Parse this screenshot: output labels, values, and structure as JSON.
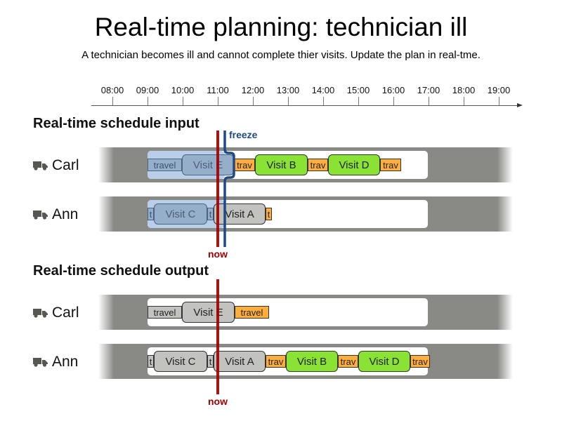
{
  "title": "Real-time planning: technician ill",
  "subtitle": "A technician becomes ill and cannot complete thier visits. Update the plan in real-tme.",
  "timeline": {
    "ticks": [
      "08:00",
      "09:00",
      "10:00",
      "11:00",
      "12:00",
      "13:00",
      "14:00",
      "15:00",
      "16:00",
      "17:00",
      "18:00",
      "19:00"
    ]
  },
  "colors": {
    "now": "#a40000",
    "freeze": "#204a87",
    "travel": "#ffad3b",
    "visit_new": "#8ae234",
    "visit_pinned": "#c2c3bf",
    "frozen_area": "#b9cfe9",
    "row_band": "#898a85"
  },
  "markers": {
    "now_label": "now",
    "freeze_label": "freeze"
  },
  "input": {
    "section_title": "Real-time schedule input",
    "rows": [
      {
        "technician": "Carl",
        "blocks": [
          {
            "type": "travel",
            "label": "travel",
            "state": "frozen"
          },
          {
            "type": "visit",
            "label": "Visit E",
            "state": "frozen"
          },
          {
            "type": "travel",
            "label": "trav",
            "state": "orange"
          },
          {
            "type": "visit",
            "label": "Visit B",
            "state": "green"
          },
          {
            "type": "travel",
            "label": "trav",
            "state": "orange"
          },
          {
            "type": "visit",
            "label": "Visit D",
            "state": "green"
          },
          {
            "type": "travel",
            "label": "trav",
            "state": "orange"
          }
        ]
      },
      {
        "technician": "Ann",
        "blocks": [
          {
            "type": "travel",
            "label": "t",
            "state": "frozen"
          },
          {
            "type": "visit",
            "label": "Visit C",
            "state": "frozen"
          },
          {
            "type": "travel",
            "label": "t",
            "state": "frozen"
          },
          {
            "type": "visit",
            "label": "Visit A",
            "state": "grey"
          },
          {
            "type": "travel",
            "label": "t",
            "state": "orange"
          }
        ]
      }
    ]
  },
  "output": {
    "section_title": "Real-time schedule output",
    "rows": [
      {
        "technician": "Carl",
        "blocks": [
          {
            "type": "travel",
            "label": "travel",
            "state": "grey"
          },
          {
            "type": "visit",
            "label": "Visit E",
            "state": "grey"
          },
          {
            "type": "travel",
            "label": "travel",
            "state": "orange"
          }
        ]
      },
      {
        "technician": "Ann",
        "blocks": [
          {
            "type": "travel",
            "label": "t",
            "state": "grey"
          },
          {
            "type": "visit",
            "label": "Visit C",
            "state": "grey"
          },
          {
            "type": "travel",
            "label": "t",
            "state": "grey"
          },
          {
            "type": "visit",
            "label": "Visit A",
            "state": "grey"
          },
          {
            "type": "travel",
            "label": "trav",
            "state": "orange"
          },
          {
            "type": "visit",
            "label": "Visit B",
            "state": "green"
          },
          {
            "type": "travel",
            "label": "trav",
            "state": "orange"
          },
          {
            "type": "visit",
            "label": "Visit D",
            "state": "green"
          },
          {
            "type": "travel",
            "label": "trav",
            "state": "orange"
          }
        ]
      }
    ]
  }
}
